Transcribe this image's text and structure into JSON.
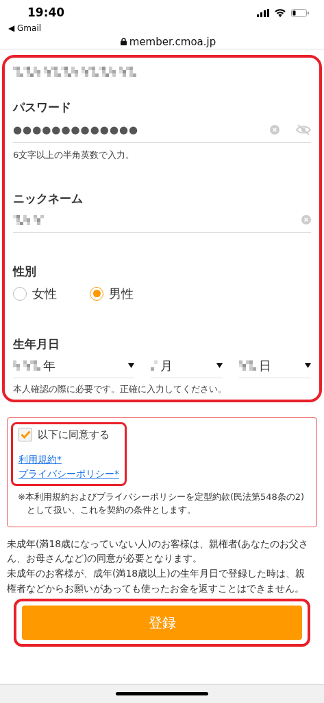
{
  "status_bar": {
    "time": "19:40",
    "back_label": "◀ Gmail"
  },
  "address_bar": {
    "url": "member.cmoa.jp"
  },
  "form": {
    "highlighted": true,
    "email": {
      "redacted": true
    },
    "password": {
      "label": "パスワード",
      "value": "●●●●●●●●●●●●●",
      "hint": "6文字以上の半角英数で入力。"
    },
    "nickname": {
      "label": "ニックネーム",
      "redacted": true
    },
    "gender": {
      "label": "性別",
      "options": [
        {
          "label": "女性",
          "selected": false
        },
        {
          "label": "男性",
          "selected": true
        }
      ]
    },
    "birthday": {
      "label": "生年月日",
      "parts": [
        {
          "suffix": "年",
          "redacted": true
        },
        {
          "suffix": "月",
          "redacted": true
        },
        {
          "suffix": "日",
          "redacted": true
        }
      ],
      "note": "本人確認の際に必要です。正確に入力してください。"
    }
  },
  "agreement": {
    "highlighted": true,
    "checkbox": {
      "label": "以下に同意する",
      "checked": true
    },
    "links": [
      "利用規約*",
      "プライバシーポリシー*"
    ],
    "note": "※本利用規約およびプライバシーポリシーを定型約款(民法第548条の2)として扱い、これを契約の条件とします。"
  },
  "notices": [
    "未成年(満18歳になっていない人)のお客様は、親権者(あなたのお父さん、お母さんなど)の同意が必要となります。",
    "未成年のお客様が、成年(満18歳以上)の生年月日で登録した時は、親権者などからお願いがあっても使ったお金を返すことはできません。"
  ],
  "submit": {
    "label": "登録",
    "highlighted": true
  }
}
